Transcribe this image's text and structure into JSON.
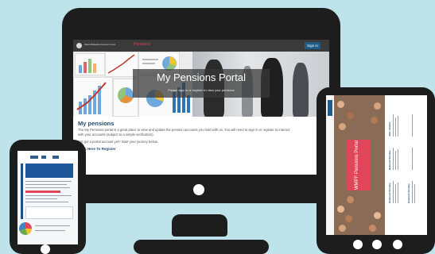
{
  "desktop": {
    "header": {
      "logo_text": "West Midlands Pension Fund",
      "nav_label": "Pensions",
      "signin_label": "Sign in"
    },
    "hero": {
      "title": "My Pensions Portal",
      "subtitle": "Please sign in or register to view your pensions"
    },
    "content": {
      "heading": "My pensions",
      "paragraph_1": "The My Pensions portal is a great place to view and update the pension accounts you hold with us. You will need to sign in or register to interact",
      "paragraph_2": "with your accounts (subject to a simple verification).",
      "paragraph_3": "Not got a portal account yet? Start your journey below.",
      "register_link": "Click Here To Register"
    }
  },
  "tablet": {
    "banner_text": "WMPF Pensions Portal",
    "columns": [
      {
        "name": "Redwood Smokey"
      },
      {
        "name": "Balwood Smokey"
      },
      {
        "name": "Julie Hinklee"
      },
      {
        "name": "Rowland Smokey"
      }
    ]
  },
  "colors": {
    "background": "#bfe3ea",
    "device_body": "#1d1d1d",
    "accent_blue": "#1f5c88",
    "nav_red": "#e0455a",
    "heading_blue": "#1f4b70"
  }
}
